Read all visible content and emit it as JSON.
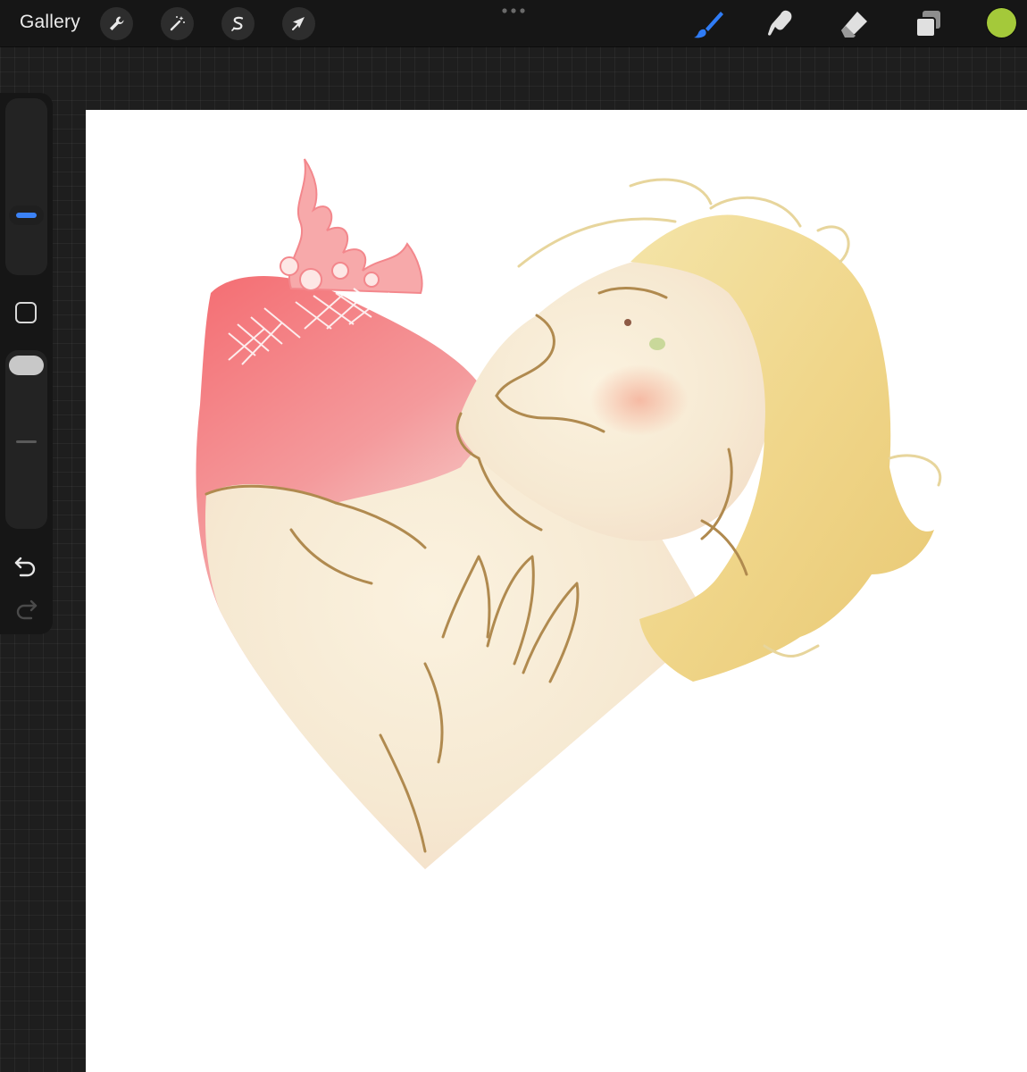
{
  "toolbar": {
    "gallery_label": "Gallery",
    "left_tools": [
      {
        "name": "actions",
        "icon": "wrench-icon"
      },
      {
        "name": "adjustments",
        "icon": "magic-wand-icon"
      },
      {
        "name": "selection",
        "icon": "selection-s-icon"
      },
      {
        "name": "transform",
        "icon": "arrow-cursor-icon"
      }
    ],
    "right_tools": [
      {
        "name": "brush",
        "icon": "brush-icon",
        "active": true,
        "color": "#2f7cf6"
      },
      {
        "name": "smudge",
        "icon": "smudge-icon",
        "active": false
      },
      {
        "name": "eraser",
        "icon": "eraser-icon",
        "active": false
      },
      {
        "name": "layers",
        "icon": "layers-icon",
        "active": false
      }
    ],
    "current_color": "#a4c93a"
  },
  "sidebar": {
    "brush_size_level": 0.6,
    "opacity_level": 1.0,
    "modify_button_icon": "square-icon",
    "undo_icon": "undo-icon",
    "redo_icon": "redo-icon",
    "size_thumb_color": "#3b82f6"
  },
  "canvas": {
    "background": "#ffffff",
    "artwork": "heart-illustration"
  }
}
